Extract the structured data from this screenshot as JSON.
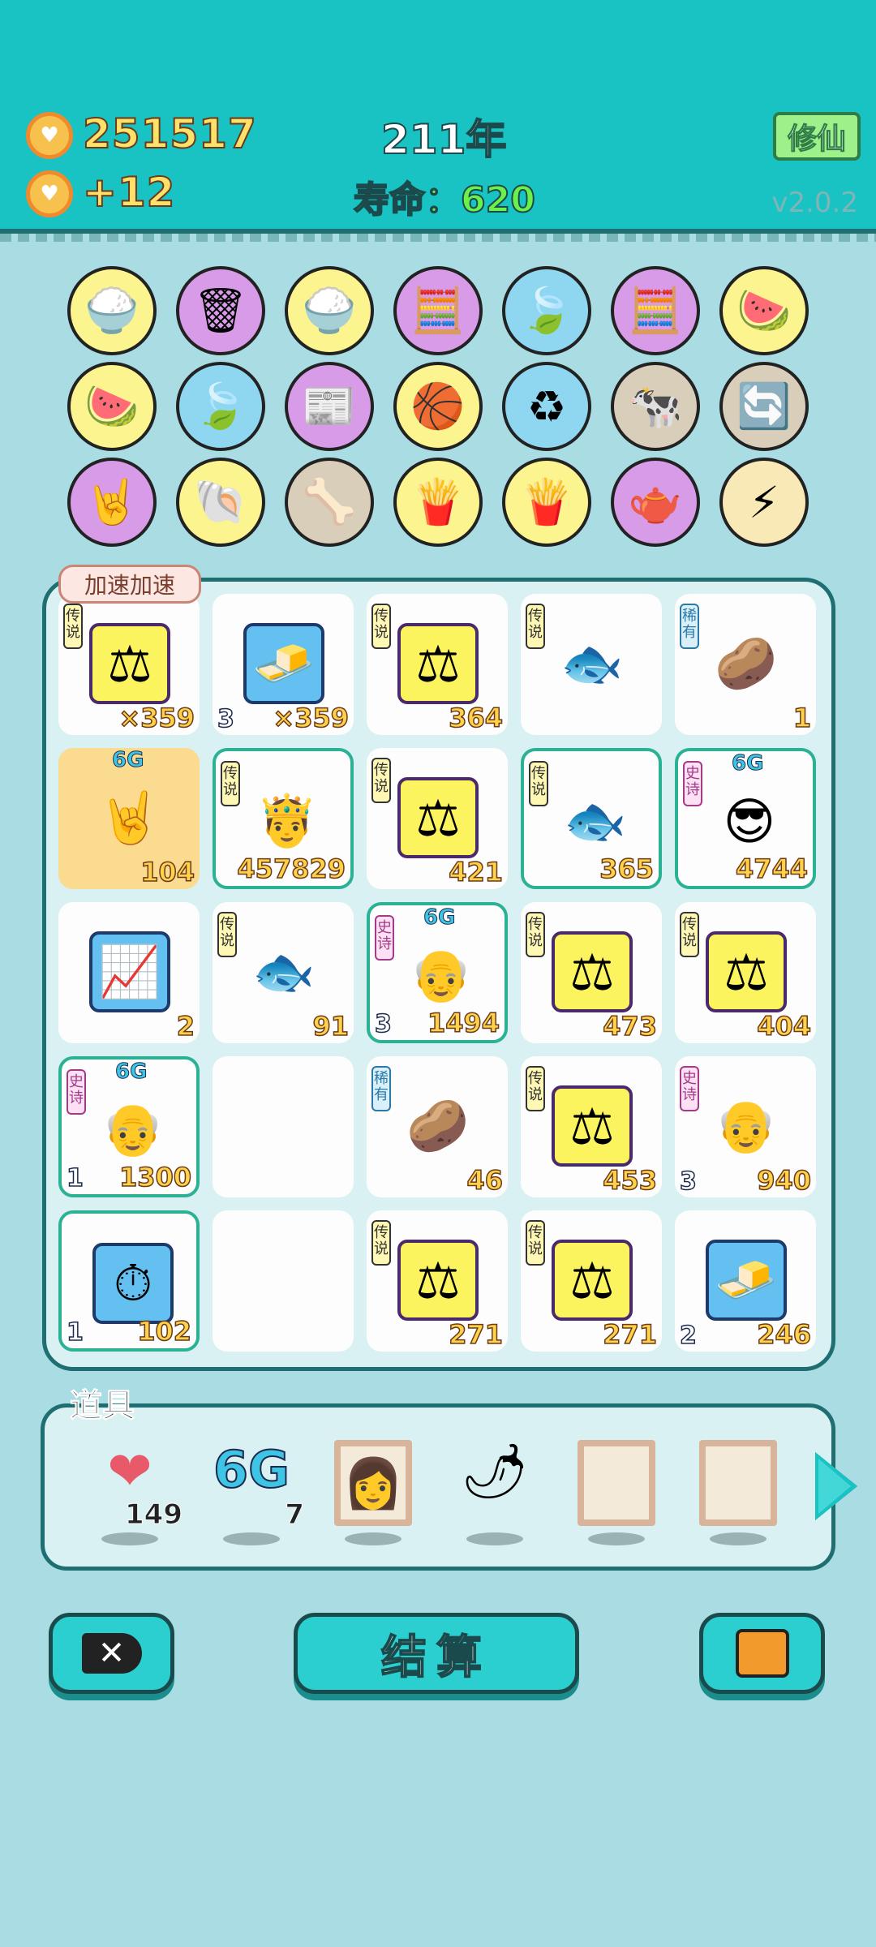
{
  "header": {
    "coins": "251517",
    "income": "+12",
    "year": "211年",
    "lifespan_label": "寿命：",
    "lifespan_value": "620",
    "xiuxian_button": "修仙",
    "version": "v2.0.2",
    "coin_icon": "heart-coin-icon"
  },
  "colors": {
    "header_bg": "#19c3c3",
    "page_bg": "#a9dde3",
    "number_yellow": "#ffe16a",
    "life_green": "#6cf04a"
  },
  "inventory_icons": [
    [
      "rice-bowl",
      "trash-can",
      "rice-bowl",
      "math-head",
      "leaf",
      "math-head",
      "fruit-basket"
    ],
    [
      "fruit-basket",
      "leaf",
      "time-magazine",
      "basketballs",
      "recycle-bag",
      "cow-pair",
      "refresh-arrows"
    ],
    [
      "rock-hand",
      "seashell",
      "pet-bowl",
      "french-fries",
      "french-fries",
      "gravy-boat",
      "lightning"
    ]
  ],
  "board": {
    "tooltip": "加速加速",
    "tags": {
      "legend": "传说",
      "epic": "史诗",
      "rare": "稀有"
    },
    "sixg": "6G",
    "cells": [
      {
        "item": "scale",
        "tag": "legend",
        "count": "×359",
        "level": ""
      },
      {
        "item": "gold-bars",
        "tag": "",
        "count": "×359",
        "level": "3"
      },
      {
        "item": "scale",
        "tag": "legend",
        "count": "364",
        "level": ""
      },
      {
        "item": "red-fish",
        "tag": "legend",
        "count": "",
        "level": ""
      },
      {
        "item": "potato",
        "tag": "rare",
        "count": "1",
        "level": ""
      },
      {
        "item": "rock-hand",
        "tag": "",
        "count": "104",
        "level": "",
        "sixg": true
      },
      {
        "item": "king-face",
        "tag": "legend",
        "count": "457829",
        "level": ""
      },
      {
        "item": "scale",
        "tag": "legend",
        "count": "421",
        "level": ""
      },
      {
        "item": "red-fish",
        "tag": "legend",
        "count": "365",
        "level": ""
      },
      {
        "item": "green-hat-face",
        "tag": "epic",
        "count": "4744",
        "level": "",
        "sixg": true
      },
      {
        "item": "growth-chart",
        "tag": "",
        "count": "2",
        "level": ""
      },
      {
        "item": "red-fish",
        "tag": "legend",
        "count": "91",
        "level": ""
      },
      {
        "item": "old-man-face",
        "tag": "epic",
        "count": "1494",
        "level": "3",
        "sixg": true
      },
      {
        "item": "scale",
        "tag": "legend",
        "count": "473",
        "level": ""
      },
      {
        "item": "scale",
        "tag": "legend",
        "count": "404",
        "level": ""
      },
      {
        "item": "old-man-face",
        "tag": "epic",
        "count": "1300",
        "level": "1",
        "sixg": true
      },
      {
        "item": "",
        "tag": "",
        "count": "",
        "level": ""
      },
      {
        "item": "potato",
        "tag": "rare",
        "count": "46",
        "level": ""
      },
      {
        "item": "scale",
        "tag": "legend",
        "count": "453",
        "level": ""
      },
      {
        "item": "old-man-face",
        "tag": "epic",
        "count": "940",
        "level": "3"
      },
      {
        "item": "stopwatch",
        "tag": "",
        "count": "102",
        "level": "1"
      },
      {
        "item": "",
        "tag": "",
        "count": "",
        "level": ""
      },
      {
        "item": "scale",
        "tag": "legend",
        "count": "271",
        "level": ""
      },
      {
        "item": "scale",
        "tag": "legend",
        "count": "271",
        "level": ""
      },
      {
        "item": "gold-bars",
        "tag": "",
        "count": "246",
        "level": "2"
      }
    ]
  },
  "props": {
    "title": "道具",
    "items": [
      {
        "icon": "liver-icon",
        "count": "149"
      },
      {
        "icon": "sixg-icon",
        "label": "6G",
        "count": "7"
      },
      {
        "icon": "portrait-frame-icon",
        "count": ""
      },
      {
        "icon": "chili-pepper-icon",
        "count": ""
      },
      {
        "icon": "empty-frame-icon",
        "count": ""
      },
      {
        "icon": "empty-frame-icon",
        "count": ""
      }
    ]
  },
  "buttons": {
    "settle": "结算",
    "close_icon": "close-icon",
    "bag_icon": "briefcase-icon"
  }
}
